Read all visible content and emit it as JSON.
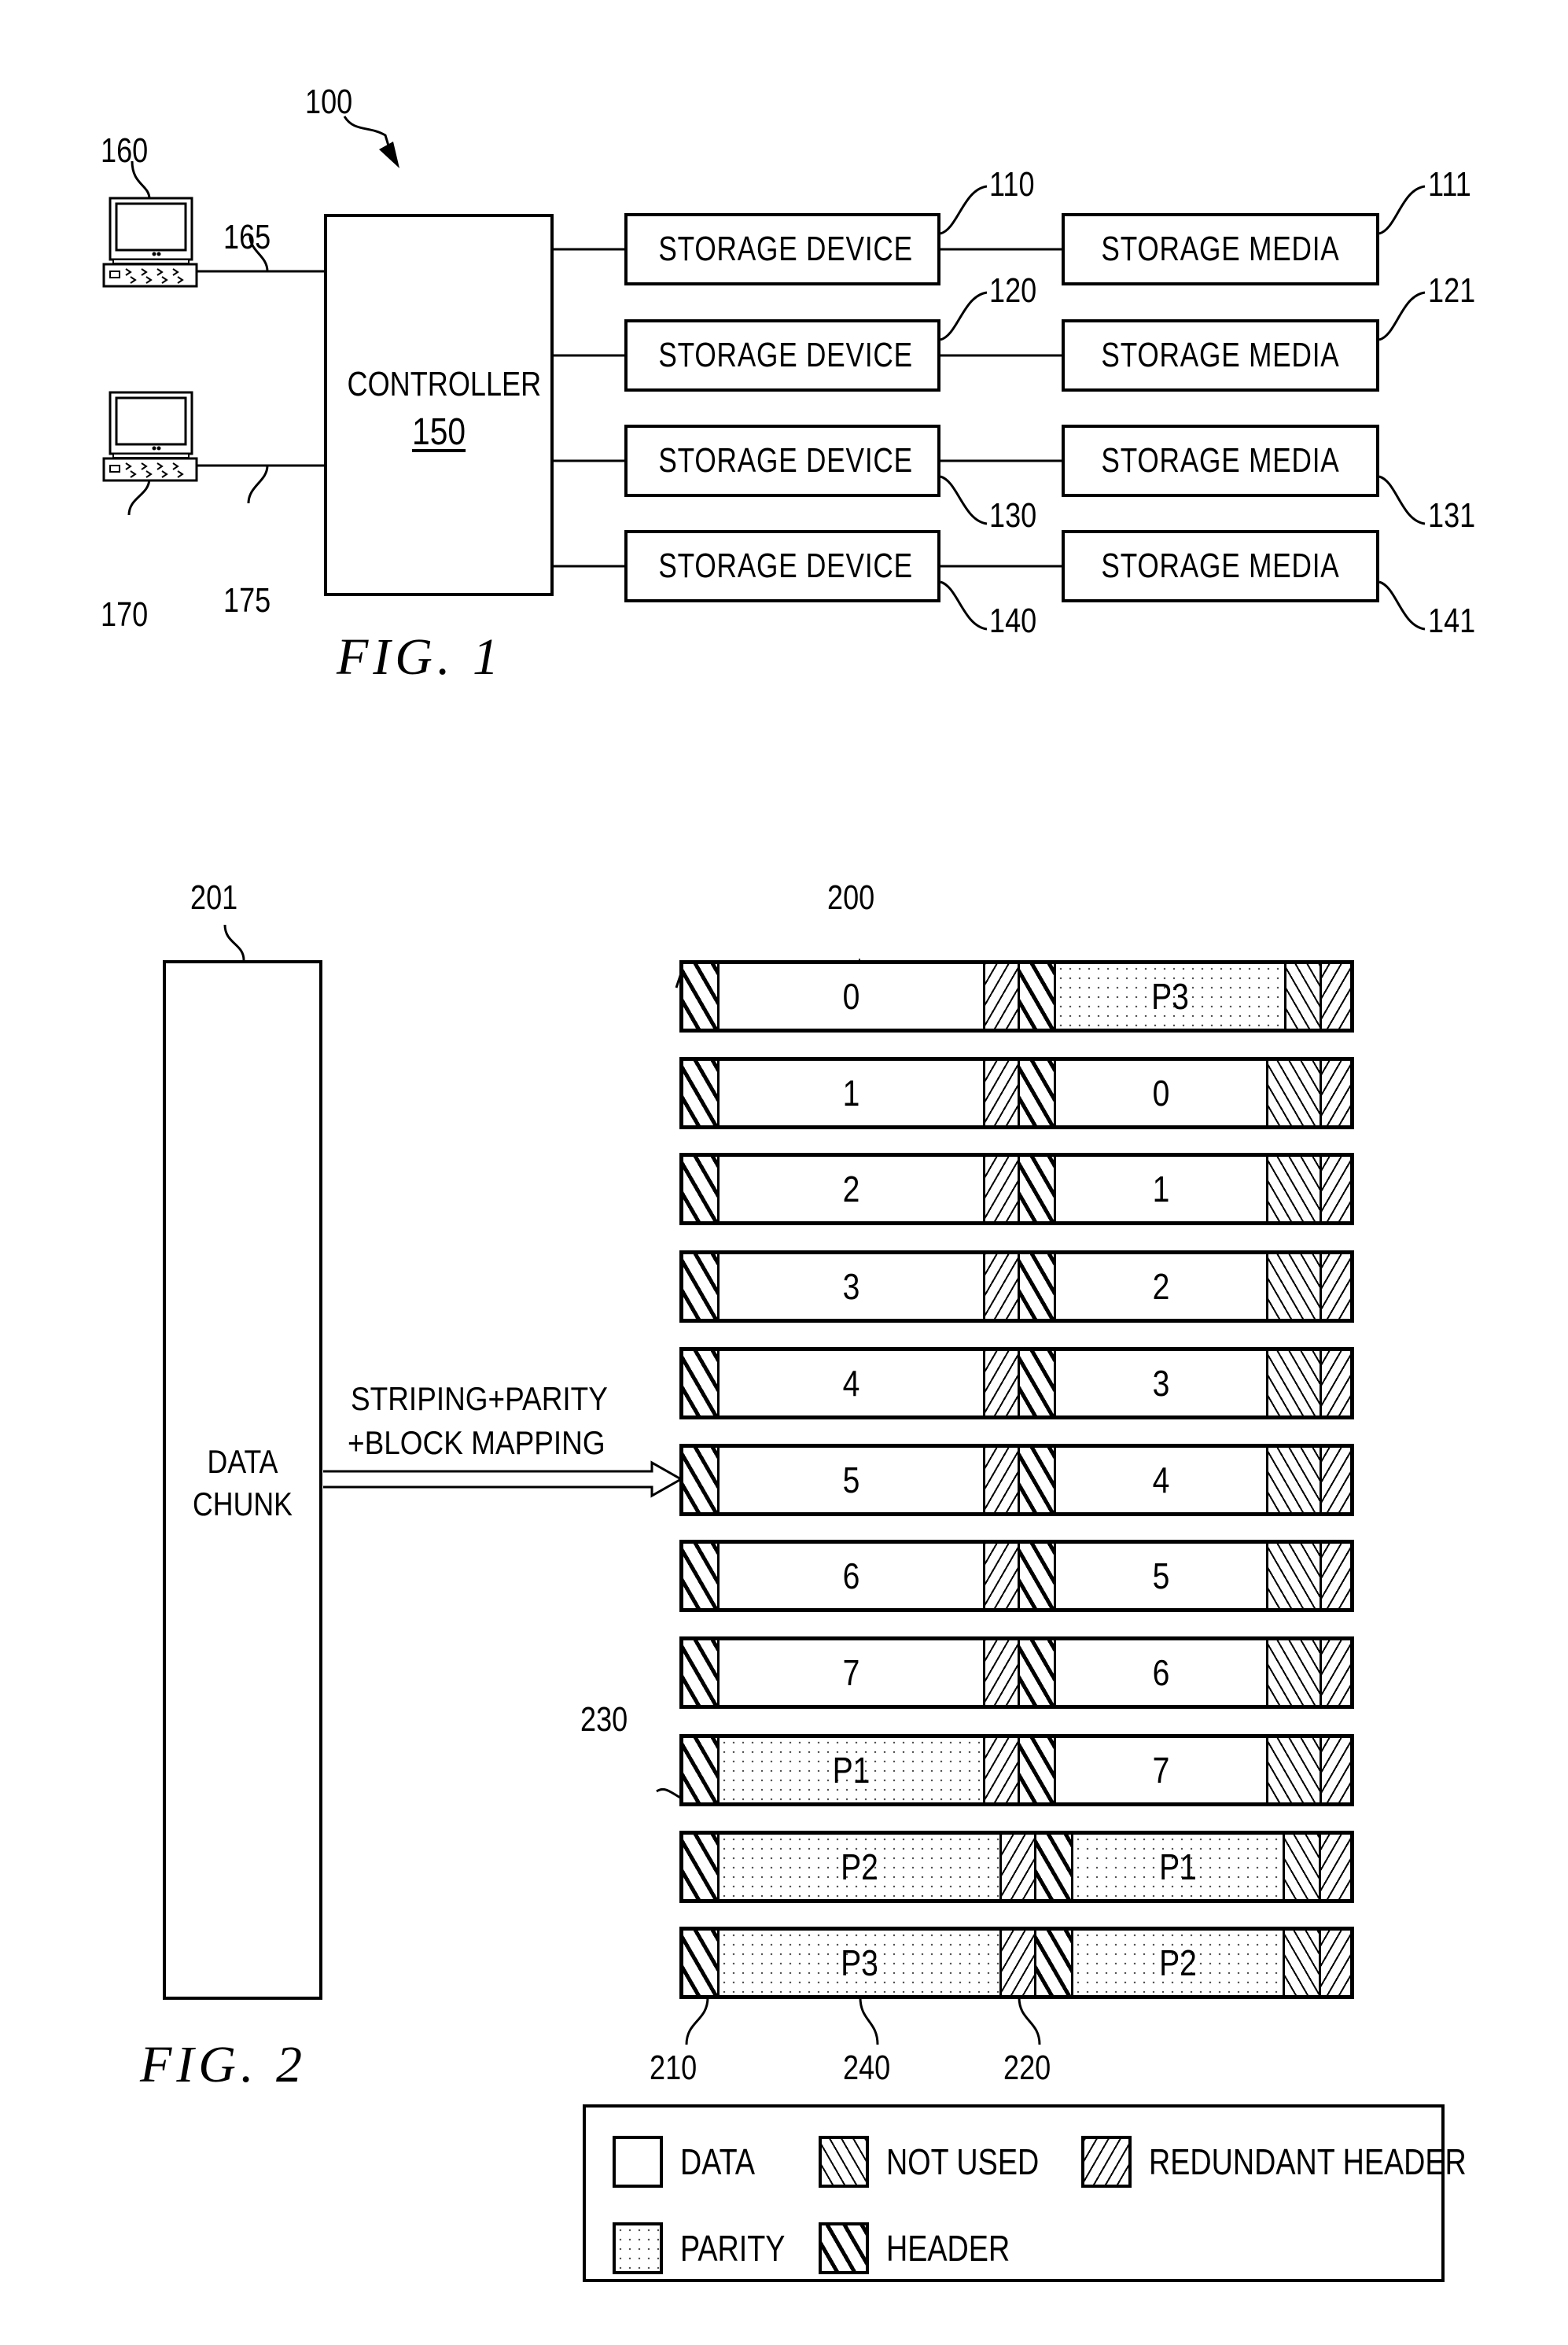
{
  "figure1": {
    "caption": "FIG. 1",
    "system_ref": "100",
    "controller": {
      "title": "CONTROLLER",
      "ref": "150"
    },
    "workstations": [
      {
        "ref": "160",
        "link_ref": "165"
      },
      {
        "ref": "170",
        "link_ref": "175"
      }
    ],
    "storage": [
      {
        "device_label": "STORAGE DEVICE",
        "device_ref": "110",
        "media_label": "STORAGE MEDIA",
        "media_ref": "111"
      },
      {
        "device_label": "STORAGE DEVICE",
        "device_ref": "120",
        "media_label": "STORAGE MEDIA",
        "media_ref": "121"
      },
      {
        "device_label": "STORAGE DEVICE",
        "device_ref": "130",
        "media_label": "STORAGE MEDIA",
        "media_ref": "131"
      },
      {
        "device_label": "STORAGE DEVICE",
        "device_ref": "140",
        "media_label": "STORAGE MEDIA",
        "media_ref": "141"
      }
    ]
  },
  "figure2": {
    "caption": "FIG. 2",
    "data_chunk": {
      "label_line1": "DATA",
      "label_line2": "CHUNK",
      "ref": "201"
    },
    "arrow_label_line1": "STRIPING+PARITY",
    "arrow_label_line2": "+BLOCK MAPPING",
    "stripe_ref": "200",
    "refs": {
      "header": "210",
      "redundant_header": "220",
      "row_gap": "230",
      "parity_block": "240"
    },
    "rows": [
      {
        "variant": "a",
        "segments": [
          [
            "header",
            ""
          ],
          [
            "data",
            "0"
          ],
          [
            "redundant",
            ""
          ],
          [
            "header",
            ""
          ],
          [
            "parity",
            "P3"
          ],
          [
            "notused",
            ""
          ],
          [
            "redundant",
            ""
          ]
        ]
      },
      {
        "variant": "b",
        "segments": [
          [
            "header",
            ""
          ],
          [
            "data",
            "1"
          ],
          [
            "redundant",
            ""
          ],
          [
            "header",
            ""
          ],
          [
            "data",
            "0"
          ],
          [
            "notused",
            ""
          ],
          [
            "redundant",
            ""
          ]
        ]
      },
      {
        "variant": "b",
        "segments": [
          [
            "header",
            ""
          ],
          [
            "data",
            "2"
          ],
          [
            "redundant",
            ""
          ],
          [
            "header",
            ""
          ],
          [
            "data",
            "1"
          ],
          [
            "notused",
            ""
          ],
          [
            "redundant",
            ""
          ]
        ]
      },
      {
        "variant": "b",
        "segments": [
          [
            "header",
            ""
          ],
          [
            "data",
            "3"
          ],
          [
            "redundant",
            ""
          ],
          [
            "header",
            ""
          ],
          [
            "data",
            "2"
          ],
          [
            "notused",
            ""
          ],
          [
            "redundant",
            ""
          ]
        ]
      },
      {
        "variant": "b",
        "segments": [
          [
            "header",
            ""
          ],
          [
            "data",
            "4"
          ],
          [
            "redundant",
            ""
          ],
          [
            "header",
            ""
          ],
          [
            "data",
            "3"
          ],
          [
            "notused",
            ""
          ],
          [
            "redundant",
            ""
          ]
        ]
      },
      {
        "variant": "b",
        "segments": [
          [
            "header",
            ""
          ],
          [
            "data",
            "5"
          ],
          [
            "redundant",
            ""
          ],
          [
            "header",
            ""
          ],
          [
            "data",
            "4"
          ],
          [
            "notused",
            ""
          ],
          [
            "redundant",
            ""
          ]
        ]
      },
      {
        "variant": "b",
        "segments": [
          [
            "header",
            ""
          ],
          [
            "data",
            "6"
          ],
          [
            "redundant",
            ""
          ],
          [
            "header",
            ""
          ],
          [
            "data",
            "5"
          ],
          [
            "notused",
            ""
          ],
          [
            "redundant",
            ""
          ]
        ]
      },
      {
        "variant": "b",
        "segments": [
          [
            "header",
            ""
          ],
          [
            "data",
            "7"
          ],
          [
            "redundant",
            ""
          ],
          [
            "header",
            ""
          ],
          [
            "data",
            "6"
          ],
          [
            "notused",
            ""
          ],
          [
            "redundant",
            ""
          ]
        ]
      },
      {
        "variant": "b",
        "segments": [
          [
            "header",
            ""
          ],
          [
            "parity",
            "P1"
          ],
          [
            "redundant",
            ""
          ],
          [
            "header",
            ""
          ],
          [
            "data",
            "7"
          ],
          [
            "notused",
            ""
          ],
          [
            "redundant",
            ""
          ]
        ]
      },
      {
        "variant": "c",
        "segments": [
          [
            "header",
            ""
          ],
          [
            "parity",
            "P2"
          ],
          [
            "redundant",
            ""
          ],
          [
            "header",
            ""
          ],
          [
            "parity",
            "P1"
          ],
          [
            "notused",
            ""
          ],
          [
            "redundant",
            ""
          ]
        ]
      },
      {
        "variant": "c",
        "segments": [
          [
            "header",
            ""
          ],
          [
            "parity",
            "P3"
          ],
          [
            "redundant",
            ""
          ],
          [
            "header",
            ""
          ],
          [
            "parity",
            "P2"
          ],
          [
            "notused",
            ""
          ],
          [
            "redundant",
            ""
          ]
        ]
      }
    ],
    "legend": [
      {
        "type": "data",
        "label": "DATA"
      },
      {
        "type": "notused",
        "label": "NOT USED"
      },
      {
        "type": "redundant",
        "label": "REDUNDANT HEADER"
      },
      {
        "type": "parity",
        "label": "PARITY"
      },
      {
        "type": "header",
        "label": "HEADER"
      }
    ]
  }
}
